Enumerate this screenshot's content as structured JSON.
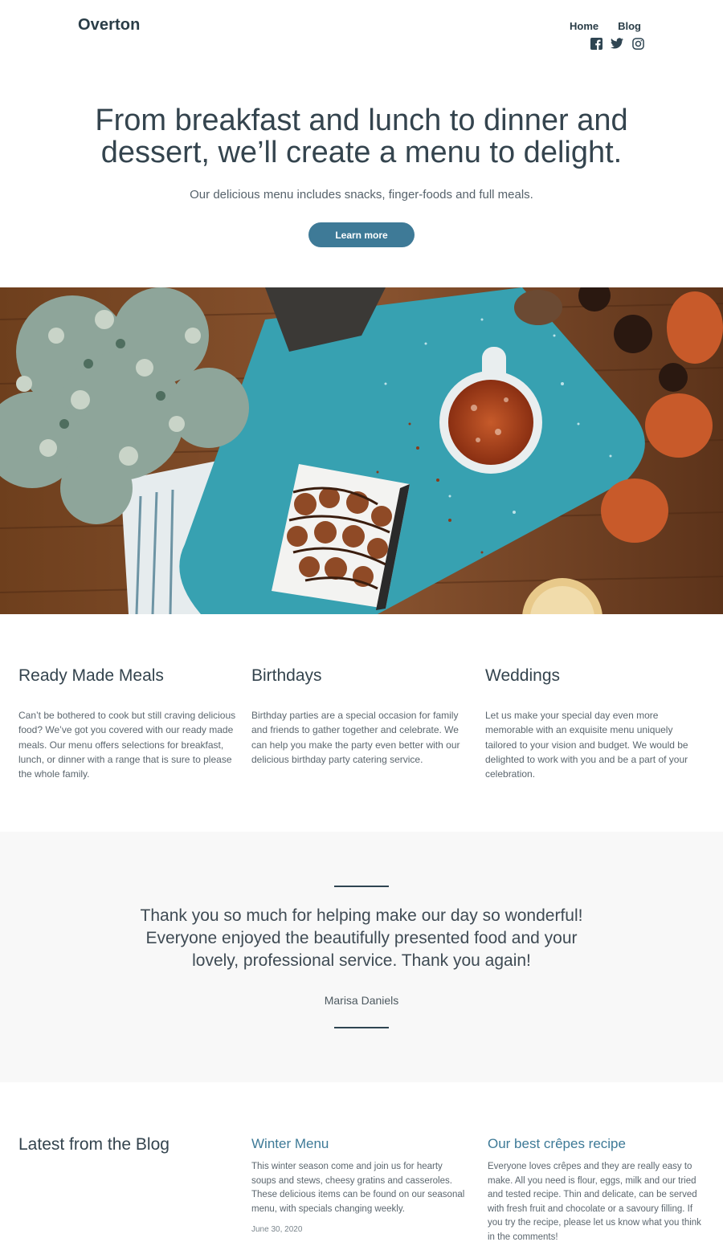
{
  "header": {
    "logo": "Overton",
    "nav": [
      {
        "label": "Home"
      },
      {
        "label": "Blog"
      }
    ],
    "social_icons": [
      "facebook-icon",
      "twitter-icon",
      "instagram-icon"
    ]
  },
  "hero": {
    "title": "From breakfast and lunch to dinner and dessert, we’ll create a menu to delight.",
    "subtitle": "Our delicious menu includes snacks, finger-foods and full meals.",
    "button_label": "Learn more"
  },
  "services": [
    {
      "title": "Ready Made Meals",
      "text": "Can’t be bothered to cook but still craving delicious food? We’ve got you covered with our ready made meals. Our menu offers selections for breakfast, lunch, or dinner with a range that is sure to please the whole family."
    },
    {
      "title": "Birthdays",
      "text": "Birthday parties are a special occasion for family and friends to gather together and celebrate. We can help you make the party even better with our delicious birthday party catering service."
    },
    {
      "title": "Weddings",
      "text": "Let us make your special day even more memorable with an exquisite menu uniquely tailored to your vision and budget. We would be delighted to work with you and be a part of your celebration."
    }
  ],
  "testimonial": {
    "quote": "Thank you so much for helping make our day so wonderful! Everyone enjoyed the beautifully presented food and your lovely, professional service. Thank you again!",
    "author": "Marisa Daniels"
  },
  "blog": {
    "heading": "Latest from the Blog",
    "posts": [
      {
        "title": "Winter Menu",
        "excerpt": "This winter season come and join us for hearty soups and stews, cheesy gratins and casseroles. These delicious items can be found on our seasonal menu, with specials changing weekly.",
        "date": "June 30, 2020"
      },
      {
        "title": "Our best crêpes recipe",
        "excerpt": "Everyone loves crêpes and they are really easy to make. All you need is flour, eggs, milk and our tried and tested recipe. Thin and delicate, can be served with fresh fruit and chocolate or a savoury filling. If you try the recipe, please let us know what you think in the comments!"
      }
    ]
  },
  "colors": {
    "accent": "#3e7a97",
    "text_dark": "#34444e",
    "testimonial_bg": "#f8f8f8"
  }
}
